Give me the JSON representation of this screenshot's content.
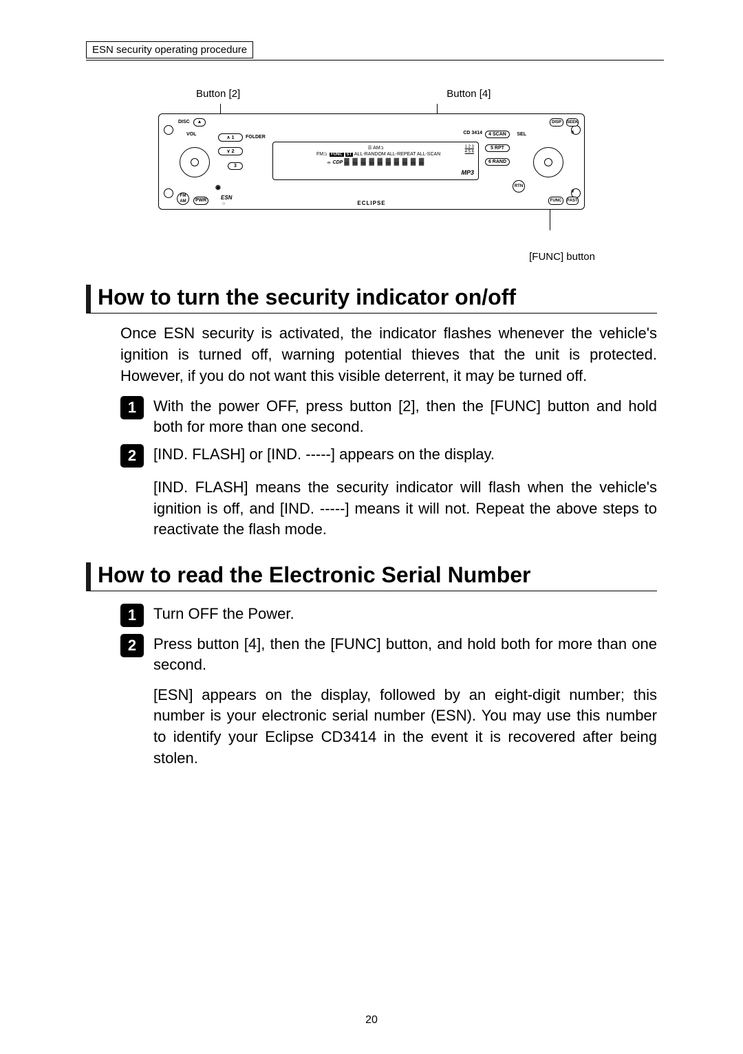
{
  "header": {
    "tag": "ESN security operating procedure"
  },
  "diagram": {
    "label_btn2": "Button [2]",
    "label_btn4": "Button [4]",
    "label_func": "[FUNC] button",
    "faceplate": {
      "disc": "DISC",
      "vol": "VOL",
      "folder": "FOLDER",
      "cd_model": "CD 3414",
      "sel": "SEL",
      "disp": "DISP",
      "seek": "SEEK",
      "fast": "FAST",
      "func": "FUNC",
      "rtn": "RTN",
      "fm_am": "FM\nAM",
      "pwr": "PWR",
      "esn": "ESN",
      "brand": "ECLIPSE",
      "btn1": "∧ 1",
      "btn2": "∨ 2",
      "btn3": "3",
      "btn4": "4 SCAN",
      "btn5": "5 RPT",
      "btn6": "6 RAND",
      "display_line1_a": "AM",
      "display_line1_b": "FM",
      "display_line1_tags": "FUNC  ST",
      "display_line1_modes": "ALL-RANDOM ALL-REPEAT ALL-SCAN",
      "display_line1_nums_top": "1  2  3",
      "display_line1_nums_bot": "4  5  6",
      "display_cdp": "CDP",
      "display_blocks": "▓ ▓ ▓ ▓ ▓ ▓ ▓ ▓ ▓ ▓",
      "display_mp3": "MP3"
    }
  },
  "section1": {
    "title": "How to turn the security indicator on/off",
    "intro": "Once ESN security is activated, the indicator flashes whenever the vehicle's ignition is turned off, warning potential thieves that the unit is protected. However, if you do not want this visible deterrent, it may be turned off.",
    "steps": [
      {
        "n": "1",
        "text": "With the power OFF, press button [2], then the [FUNC] button and hold both for more than one second."
      },
      {
        "n": "2",
        "text": "[IND. FLASH] or [IND. -----] appears on the display."
      }
    ],
    "note": "[IND. FLASH] means the security indicator will flash when the vehicle's ignition is off, and [IND. -----] means it will not. Repeat the above steps to reactivate the flash mode."
  },
  "section2": {
    "title": "How to read the Electronic Serial Number",
    "steps": [
      {
        "n": "1",
        "text": "Turn OFF the Power."
      },
      {
        "n": "2",
        "text": "Press button [4], then the [FUNC] button, and hold both for more than one second."
      }
    ],
    "note": "[ESN] appears on the display, followed by an eight-digit number; this number is your electronic serial number (ESN). You may use this number to identify your Eclipse CD3414 in the event it is recovered after being stolen."
  },
  "page_number": "20"
}
